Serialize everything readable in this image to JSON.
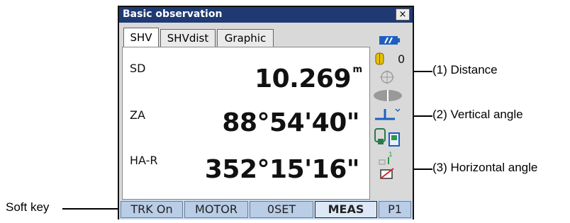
{
  "window": {
    "title": "Basic observation",
    "close_label": "×"
  },
  "tabs": [
    {
      "label": "SHV",
      "active": true
    },
    {
      "label": "SHVdist",
      "active": false
    },
    {
      "label": "Graphic",
      "active": false
    }
  ],
  "readings": {
    "sd": {
      "label": "SD",
      "value": "10.269",
      "unit": "m"
    },
    "za": {
      "label": "ZA",
      "value": "88°54'40\""
    },
    "ha": {
      "label": "HA-R",
      "value": "352°15'16\""
    }
  },
  "status": {
    "counter": "0",
    "signal_level": "1",
    "battery_icon": "battery-icon",
    "prism_icon": "prism-icon",
    "target_icon": "crosshair-icon",
    "laser_icon": "laser-icon",
    "tilt_icon": "tilt-icon",
    "comm_icon": "bluetooth-device-icon",
    "input_icon": "input-mode-icon"
  },
  "softkeys": [
    "TRK On",
    "MOTOR",
    "0SET",
    "MEAS",
    "P1"
  ],
  "annotations": {
    "distance": "(1) Distance",
    "vertical_angle": "(2) Vertical angle",
    "horizontal_angle": "(3) Horizontal angle",
    "soft_key": "Soft key"
  },
  "colors": {
    "titlebar": "#1f3a73",
    "softkey_bar": "#c9d9ec",
    "icon_blue": "#1d5fbf"
  }
}
